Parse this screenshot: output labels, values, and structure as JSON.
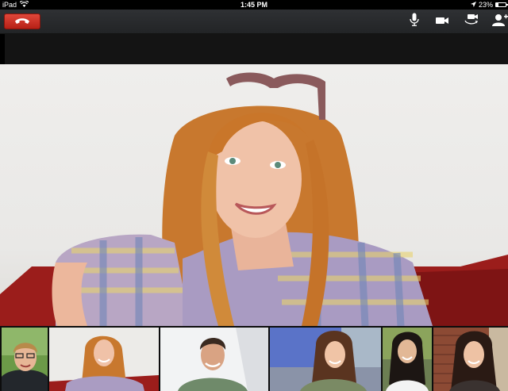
{
  "status_bar": {
    "device": "iPad",
    "time": "1:45 PM",
    "battery": "23%",
    "battery_level": 0.23
  },
  "toolbar": {
    "hangup_icon": "phone-hangup-icon",
    "buttons": [
      {
        "name": "microphone-icon"
      },
      {
        "name": "camera-icon"
      },
      {
        "name": "switch-camera-icon"
      },
      {
        "name": "add-person-icon"
      }
    ]
  },
  "colors": {
    "hangup_red": "#c9302a",
    "toolbar_bg": "#2a2c2f",
    "selected_outline": "#3b8fd4"
  },
  "main_video": {
    "participant_icon": "woman-participant-video"
  },
  "thumbnails": [
    {
      "subject": "man-with-glasses"
    },
    {
      "subject": "red-haired-woman"
    },
    {
      "subject": "smiling-man"
    },
    {
      "subject": "brunette-woman"
    },
    {
      "subject": "dark-haired-woman"
    },
    {
      "subject": "woman-with-brick-wall"
    }
  ]
}
